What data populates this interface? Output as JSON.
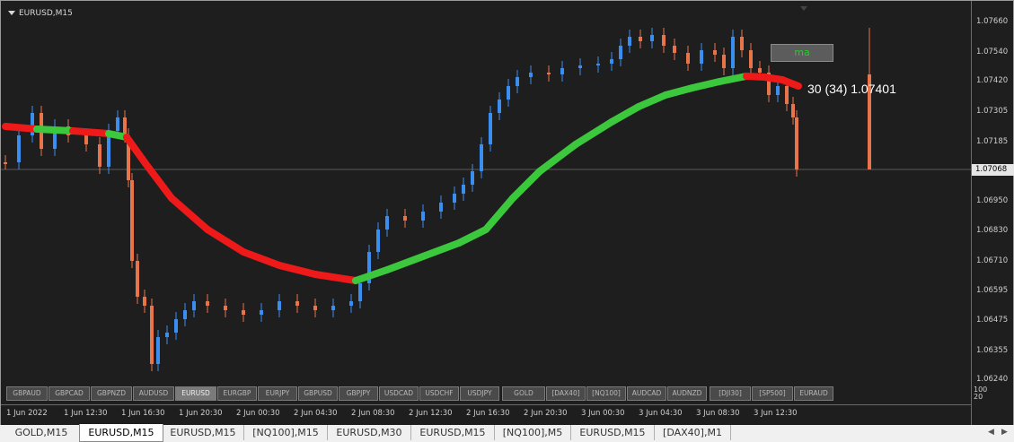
{
  "window": {
    "title": "EURUSD,M15"
  },
  "indicator": {
    "button_label": "ma",
    "last_label": "30 (34) 1.07401"
  },
  "price_scale": {
    "labels": [
      "1.07660",
      "1.07540",
      "1.07420",
      "1.07305",
      "1.07185",
      "1.06950",
      "1.06830",
      "1.06710",
      "1.06595",
      "1.06475",
      "1.06355",
      "1.06240"
    ],
    "current_price": "1.07068"
  },
  "indicator_scale": {
    "top": "100",
    "bottom": "20"
  },
  "symbol_buttons": [
    "GBPAUD",
    "GBPCAD",
    "GBPNZD",
    "AUDUSD",
    "EURUSD",
    "EURGBP",
    "EURJPY",
    "GBPUSD",
    "GBPJPY",
    "USDCAD",
    "USDCHF",
    "USDJPY",
    "GOLD",
    "[DAX40]",
    "[NQ100]",
    "AUDCAD",
    "AUDNZD",
    "[DJI30]",
    "[SP500]",
    "EURAUD"
  ],
  "active_symbol": "EURUSD",
  "time_axis": [
    "1 Jun 2022",
    "1 Jun 12:30",
    "1 Jun 16:30",
    "1 Jun 20:30",
    "2 Jun 00:30",
    "2 Jun 04:30",
    "2 Jun 08:30",
    "2 Jun 12:30",
    "2 Jun 16:30",
    "2 Jun 20:30",
    "3 Jun 00:30",
    "3 Jun 04:30",
    "3 Jun 08:30",
    "3 Jun 12:30"
  ],
  "tabs": [
    "GOLD,M15",
    "EURUSD,M15",
    "EURUSD,M15",
    "[NQ100],M15",
    "EURUSD,M30",
    "EURUSD,M15",
    "[NQ100],M5",
    "EURUSD,M15",
    "[DAX40],M1"
  ],
  "active_tab": 1,
  "colors": {
    "background": "#1e1e1e",
    "bull": "#3a8ef0",
    "bear": "#e8744a",
    "ma_up": "#3cc83c",
    "ma_down": "#ee1a1a",
    "text": "#d8d8d8"
  }
}
